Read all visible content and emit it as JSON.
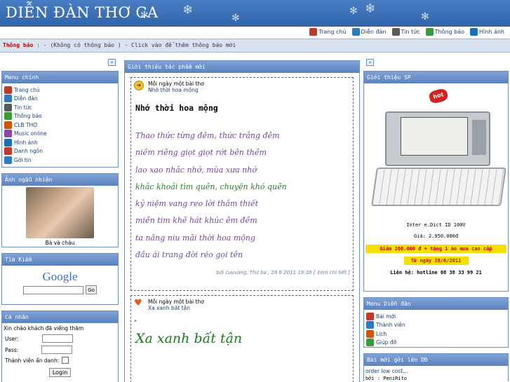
{
  "site": {
    "title": "DIỄN ĐÀN THƠ CA"
  },
  "topnav": [
    {
      "label": "Trang chủ",
      "icon": "home-icon",
      "color": "#c0392b"
    },
    {
      "label": "Diễn đàn",
      "icon": "forum-icon",
      "color": "#2c7bc1"
    },
    {
      "label": "Tin tức",
      "icon": "news-icon",
      "color": "#5a5a5a"
    },
    {
      "label": "Thông báo",
      "icon": "notice-icon",
      "color": "#3a9a3a"
    },
    {
      "label": "Hình ảnh",
      "icon": "image-icon",
      "color": "#1a6fb8"
    }
  ],
  "announce": {
    "label": "Thông báo",
    "text": " : - (Không có thông báo ) - Click vào để thêm thông báo mới"
  },
  "left": {
    "collapse": "«",
    "menu": {
      "title": "Menu chính",
      "items": [
        {
          "label": "Trang chủ",
          "color": "#c0392b"
        },
        {
          "label": "Diễn đàn",
          "color": "#2c7bc1"
        },
        {
          "label": "Tin tức",
          "color": "#5a5a5a"
        },
        {
          "label": "Thông báo",
          "color": "#3a9a3a"
        },
        {
          "label": "CLB THƠ",
          "color": "#d35400"
        },
        {
          "label": "Music online",
          "color": "#8e44ad"
        },
        {
          "label": "Hình ảnh",
          "color": "#1a6fb8"
        },
        {
          "label": "Danh ngôn",
          "color": "#c0392b"
        },
        {
          "label": "Gởi tin",
          "color": "#2c7bc1"
        }
      ]
    },
    "random_photo": {
      "title": "Ảnh ngẫu nhiên",
      "caption": "Bà và cháu"
    },
    "search": {
      "title": "Tìm Kiếm",
      "logo": "Google",
      "button": "Go"
    },
    "personal": {
      "title": "Cá nhân",
      "greeting": "Xin chào khách đã viếng thăm",
      "user": "User:",
      "pass": "Pass:",
      "hidden": "Thành viên ẩn danh:",
      "login": "Login"
    }
  },
  "center": {
    "title": "Giới thiệu tác phẩm mới",
    "post1": {
      "head1": "Mỗi ngày một bài thơ",
      "head2": "Nhớ thời hoa mộng",
      "title": "Nhớ thời hoa mộng",
      "lines": [
        "Thao thức từng đêm, thức trắng đêm",
        "niềm riêng giọt giọt rớt bên thềm",
        "lao xao nhắc nhớ, mùa xưa nhớ",
        "khắc khoải tìm quên, chuyện khó quên",
        "kỷ niệm vang reo lời thắm thiết",
        "miền tim khẽ hát khúc êm đềm",
        "ta nâng niu mãi thời hoa mộng",
        "đầu ái trang đời réo gọi tên"
      ],
      "byline": "bởi cuuvang, Thứ ba , 28 6 2011 19:26 [ Xem chi tiết ]"
    },
    "post2": {
      "head1": "Mỗi ngày một bài thơ",
      "head2": "Xa xanh bất tận",
      "mark": "\"",
      "title": "Xa xanh bất tận"
    }
  },
  "right": {
    "collapse": "»",
    "product": {
      "title": "Giới thiệu SP",
      "badge": "hot",
      "name": "Inter e.Dict ID 100V",
      "price": "Giá: 2.950.000đ",
      "promo": "Giảm 200.000 đ + tặng 1 áo mưa cao cấp",
      "from": "Từ ngày 28/6/2011",
      "contact": "Liên hệ: hotline 08 38 33 99 21"
    },
    "forum_menu": {
      "title": "Menu Diễn đàn",
      "items": [
        {
          "label": "Bài mới",
          "color": "#c0392b"
        },
        {
          "label": "Thành viên",
          "color": "#2c7bc1"
        },
        {
          "label": "Lịch",
          "color": "#d35400"
        },
        {
          "label": "Giúp đỡ",
          "color": "#3a9a3a"
        }
      ]
    },
    "latest": {
      "title": "Bài mới gởi lên DĐ",
      "item": "order low cost...",
      "by": "bởi : PeniRito"
    }
  }
}
